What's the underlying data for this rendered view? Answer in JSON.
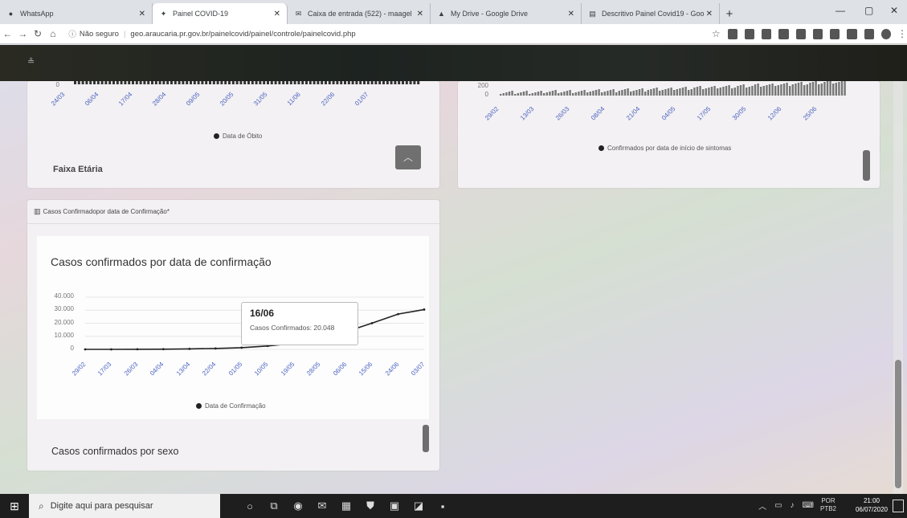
{
  "browser": {
    "tabs": [
      {
        "label": "WhatsApp",
        "icon": "whatsapp-icon",
        "active": false
      },
      {
        "label": "Painel COVID-19",
        "icon": "app-icon",
        "active": true
      },
      {
        "label": "Caixa de entrada (522) - maagel",
        "icon": "mail-icon",
        "active": false
      },
      {
        "label": "My Drive - Google Drive",
        "icon": "drive-icon",
        "active": false
      },
      {
        "label": "Descritivo Painel Covid19 - Goo",
        "icon": "doc-icon",
        "active": false
      }
    ],
    "security_label": "Não seguro",
    "url": "geo.araucaria.pr.gov.br/painelcovid/painel/controle/painelcovid.php"
  },
  "top_left_card": {
    "x_ticks": [
      "24/03",
      "06/04",
      "17/04",
      "28/04",
      "09/05",
      "20/05",
      "31/05",
      "11/06",
      "22/06",
      "01/07"
    ],
    "y_zero": "0",
    "legend": "Data de Óbito",
    "section_title": "Faixa Etária"
  },
  "top_right_card": {
    "y_top": "200",
    "y_zero": "0",
    "x_ticks": [
      "29/02",
      "13/03",
      "26/03",
      "08/04",
      "21/04",
      "04/05",
      "17/05",
      "30/05",
      "12/06",
      "25/06"
    ],
    "legend": "Confirmados por data de início de sintomas"
  },
  "confirm_panel": {
    "header": "Casos Confirmadopor data de Confirmação*",
    "chart_title": "Casos confirmados por data de confirmação",
    "legend": "Data de Confirmação",
    "next_section": "Casos confirmados por sexo",
    "tooltip": {
      "date": "16/06",
      "text": "Casos Confirmados: 20.048"
    }
  },
  "chart_data": {
    "type": "line",
    "title": "Casos confirmados por data de confirmação",
    "xlabel": "",
    "ylabel": "",
    "y_ticks": [
      "0",
      "10.000",
      "20.000",
      "30.000",
      "40.000"
    ],
    "ylim": [
      0,
      40000
    ],
    "categories": [
      "29/02",
      "17/03",
      "26/03",
      "04/04",
      "13/04",
      "22/04",
      "01/05",
      "10/05",
      "19/05",
      "28/05",
      "06/06",
      "15/06",
      "24/06",
      "03/07"
    ],
    "series": [
      {
        "name": "Data de Confirmação",
        "color": "#222222",
        "values": [
          0,
          20,
          60,
          150,
          350,
          700,
          1300,
          2600,
          4700,
          8200,
          13500,
          20048,
          27000,
          30500
        ]
      }
    ],
    "legend_position": "bottom",
    "grid": true
  },
  "taskbar": {
    "search_placeholder": "Digite aqui para pesquisar",
    "lang": "POR",
    "lang_sub": "PTB2",
    "time": "21:00",
    "date": "06/07/2020"
  },
  "colors": {
    "tick_text": "#4a62c2",
    "header_bg": "#22261f",
    "line": "#222222"
  }
}
